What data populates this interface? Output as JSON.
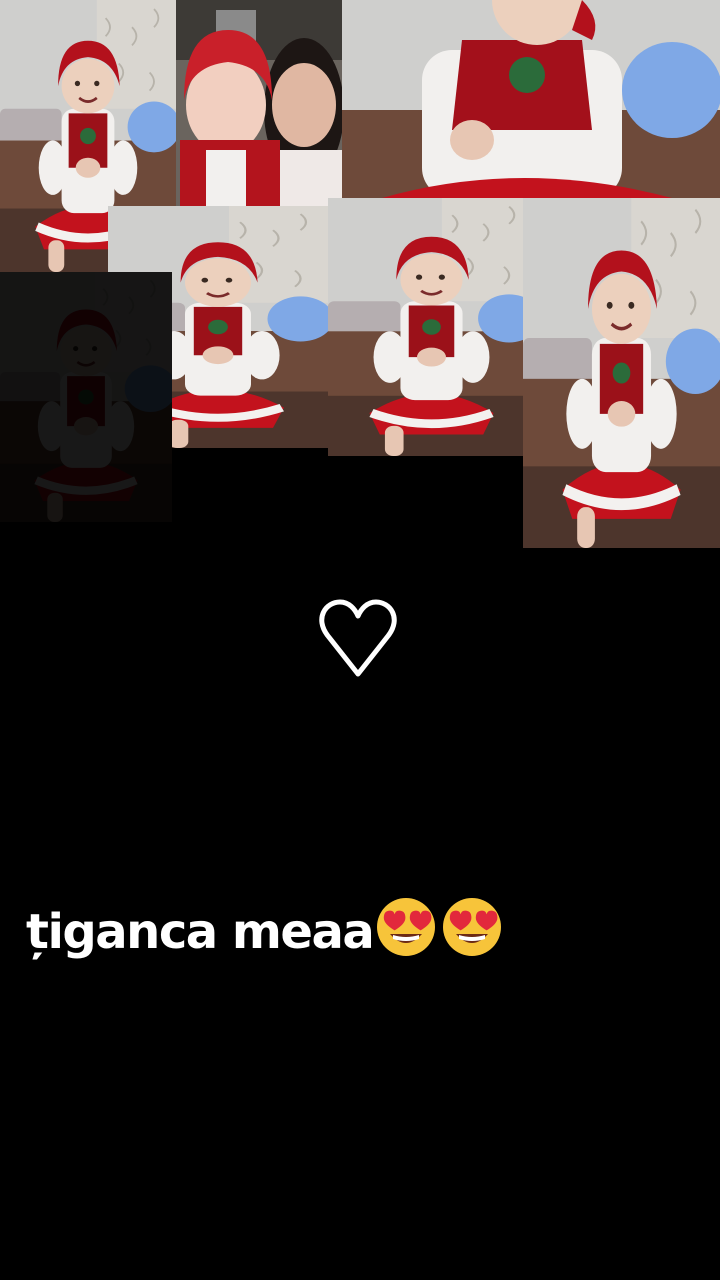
{
  "caption": {
    "text": "țiganca meaa",
    "emoji": [
      "smiling-face-with-heart-eyes",
      "smiling-face-with-heart-eyes"
    ]
  },
  "heart_icon": "white-heart-outline",
  "colors": {
    "background": "#000000",
    "dress_red": "#c3121d",
    "blouse_white": "#f2f0ee",
    "balloon_blue": "#7fa8e6",
    "floor_brown": "#6e4a3a",
    "wall_grey": "#cfcfcd"
  },
  "collage": {
    "photo_count": 7
  }
}
